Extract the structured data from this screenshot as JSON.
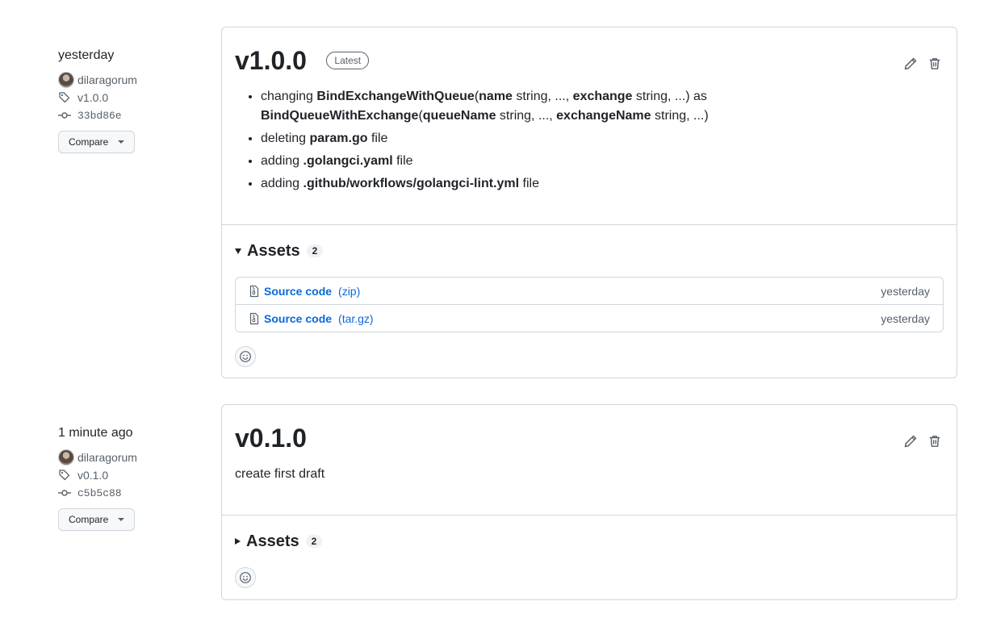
{
  "releases": [
    {
      "date": "yesterday",
      "author": "dilaragorum",
      "tag": "v1.0.0",
      "commit": "33bd86e",
      "compare_label": "Compare",
      "title": "v1.0.0",
      "badge": "Latest",
      "notes": [
        {
          "parts": [
            {
              "t": "changing ",
              "b": false
            },
            {
              "t": "BindExchangeWithQueue",
              "b": true
            },
            {
              "t": "(",
              "b": false
            },
            {
              "t": "name",
              "b": true
            },
            {
              "t": " string, ..., ",
              "b": false
            },
            {
              "t": "exchange",
              "b": true
            },
            {
              "t": " string, ...) as ",
              "b": false
            },
            {
              "t": "BindQueueWithExchange",
              "b": true
            },
            {
              "t": "(",
              "b": false
            },
            {
              "t": "queueName",
              "b": true
            },
            {
              "t": " string, ..., ",
              "b": false
            },
            {
              "t": "exchangeName",
              "b": true
            },
            {
              "t": " string, ...)",
              "b": false
            }
          ]
        },
        {
          "parts": [
            {
              "t": "deleting ",
              "b": false
            },
            {
              "t": "param.go",
              "b": true
            },
            {
              "t": " file",
              "b": false
            }
          ]
        },
        {
          "parts": [
            {
              "t": "adding ",
              "b": false
            },
            {
              "t": ".golangci.yaml",
              "b": true
            },
            {
              "t": " file",
              "b": false
            }
          ]
        },
        {
          "parts": [
            {
              "t": "adding ",
              "b": false
            },
            {
              "t": ".github/workflows/golangci-lint.yml",
              "b": true
            },
            {
              "t": " file",
              "b": false
            }
          ]
        }
      ],
      "assets_label": "Assets",
      "assets_count": "2",
      "assets": [
        {
          "name": "Source code",
          "ext": "(zip)",
          "time": "yesterday"
        },
        {
          "name": "Source code",
          "ext": "(tar.gz)",
          "time": "yesterday"
        }
      ]
    },
    {
      "date": "1 minute ago",
      "author": "dilaragorum",
      "tag": "v0.1.0",
      "commit": "c5b5c88",
      "compare_label": "Compare",
      "title": "v0.1.0",
      "description": "create first draft",
      "assets_label": "Assets",
      "assets_count": "2"
    }
  ],
  "icons": {
    "tag": "tag-icon",
    "commit": "git-commit-icon",
    "edit": "pencil-icon",
    "delete": "trash-icon",
    "zip": "file-zip-icon",
    "reaction": "smiley-icon"
  },
  "colors": {
    "link": "#0969da",
    "border": "#d0d7de",
    "muted": "#57606a",
    "text": "#1f2328"
  }
}
